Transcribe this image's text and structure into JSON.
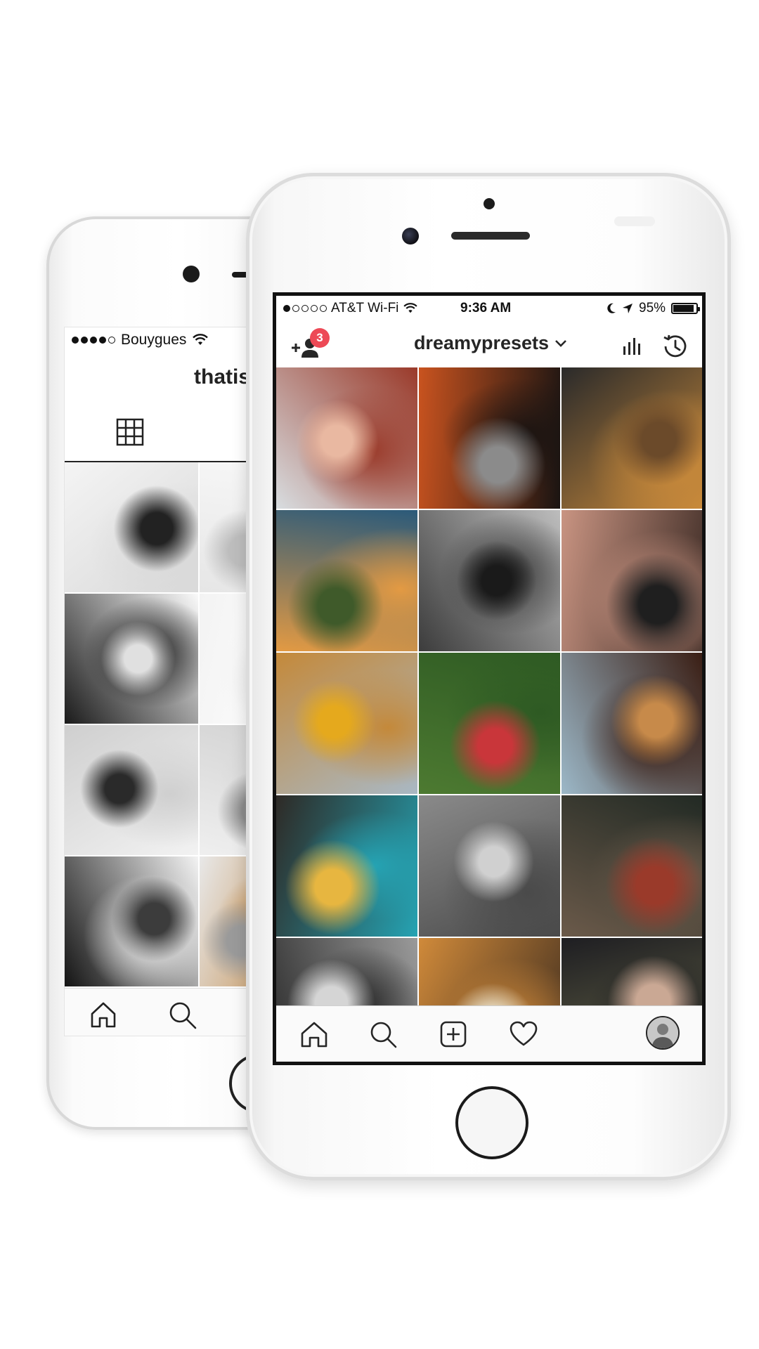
{
  "back_phone": {
    "status": {
      "carrier": "Bouygues",
      "signal_dots_filled": 4,
      "signal_dots_total": 5
    },
    "profile_title": "thatis",
    "tiles": [
      {
        "name": "earphones-phone",
        "colors": [
          "#f4f4f4",
          "#d9d9d9",
          "#222222"
        ]
      },
      {
        "name": "white-desk",
        "colors": [
          "#f7f7f7",
          "#e6e6e6",
          "#bdbdbd"
        ]
      },
      {
        "name": "black-sneakers",
        "colors": [
          "#fafafa",
          "#1b1b1b",
          "#e0e0e0"
        ]
      },
      {
        "name": "white-blank",
        "colors": [
          "#ffffff",
          "#f3f3f3",
          "#eeeeee"
        ]
      },
      {
        "name": "white-feathers",
        "colors": [
          "#f2f2f2",
          "#cfcfcf",
          "#2a2a2a"
        ]
      },
      {
        "name": "paper-stack",
        "colors": [
          "#efefef",
          "#d2d2d2",
          "#8c8c8c"
        ]
      },
      {
        "name": "playing-cards",
        "colors": [
          "#141414",
          "#f3f3f3",
          "#3c3c3c"
        ]
      },
      {
        "name": "newspaper-croissant",
        "colors": [
          "#e8e8e8",
          "#c08a4a",
          "#9a9a9a"
        ]
      }
    ]
  },
  "front_phone": {
    "status": {
      "carrier": "AT&T Wi-Fi",
      "time": "9:36 AM",
      "battery": "95%",
      "battery_level": 0.95,
      "signal_dots_filled": 1,
      "signal_dots_total": 5
    },
    "header": {
      "username": "dreamypresets",
      "notification_count": "3"
    },
    "grid": [
      {
        "name": "red-hair-portrait",
        "colors": [
          "#d8dde0",
          "#9a3a2a",
          "#e9b8a1"
        ]
      },
      {
        "name": "chocolate-cup",
        "colors": [
          "#c9531f",
          "#1a1412",
          "#8b8b8b"
        ]
      },
      {
        "name": "golden-retriever",
        "colors": [
          "#2a2a2a",
          "#c98a3b",
          "#6b4a2a"
        ]
      },
      {
        "name": "mountain-sunset",
        "colors": [
          "#2b5a7a",
          "#e39a43",
          "#3f5a2a"
        ]
      },
      {
        "name": "bw-lips",
        "colors": [
          "#bdbdbd",
          "#3c3c3c",
          "#1a1a1a"
        ]
      },
      {
        "name": "couple-selfie",
        "colors": [
          "#3b2a24",
          "#c99482",
          "#1f1f1f"
        ]
      },
      {
        "name": "dog-mountain",
        "colors": [
          "#a9b8c4",
          "#c4893a",
          "#e5a91d"
        ]
      },
      {
        "name": "woman-green-wall",
        "colors": [
          "#4d7a31",
          "#2e5a23",
          "#c9363a"
        ]
      },
      {
        "name": "chocolate-cake",
        "colors": [
          "#9cb8c8",
          "#3a1e14",
          "#c78a4a"
        ]
      },
      {
        "name": "brownie-plate",
        "colors": [
          "#2e2a26",
          "#25a3b3",
          "#e7b640"
        ]
      },
      {
        "name": "bw-eye",
        "colors": [
          "#8a8a8a",
          "#4a4a4a",
          "#d0d0d0"
        ]
      },
      {
        "name": "town-window",
        "colors": [
          "#222a24",
          "#6b5a4a",
          "#9a3a2a"
        ]
      },
      {
        "name": "bw-couple",
        "colors": [
          "#9a9a9a",
          "#2a2a2a",
          "#d5d5d5"
        ]
      },
      {
        "name": "food-bowls",
        "colors": [
          "#3a2a1e",
          "#d08a3a",
          "#e9e0c8"
        ]
      },
      {
        "name": "couple-grass",
        "colors": [
          "#6b6a4a",
          "#1e1e22",
          "#caa894"
        ]
      }
    ]
  },
  "icons": {
    "add_user": "add-user-icon",
    "chevron": "chevron-down-icon",
    "stats": "bar-chart-icon",
    "history": "history-icon",
    "grid": "grid-icon",
    "home": "home-icon",
    "search": "search-icon",
    "add": "add-post-icon",
    "heart": "heart-icon",
    "profile": "profile-avatar",
    "wifi": "wifi-icon",
    "moon": "moon-icon",
    "location": "location-arrow-icon"
  }
}
